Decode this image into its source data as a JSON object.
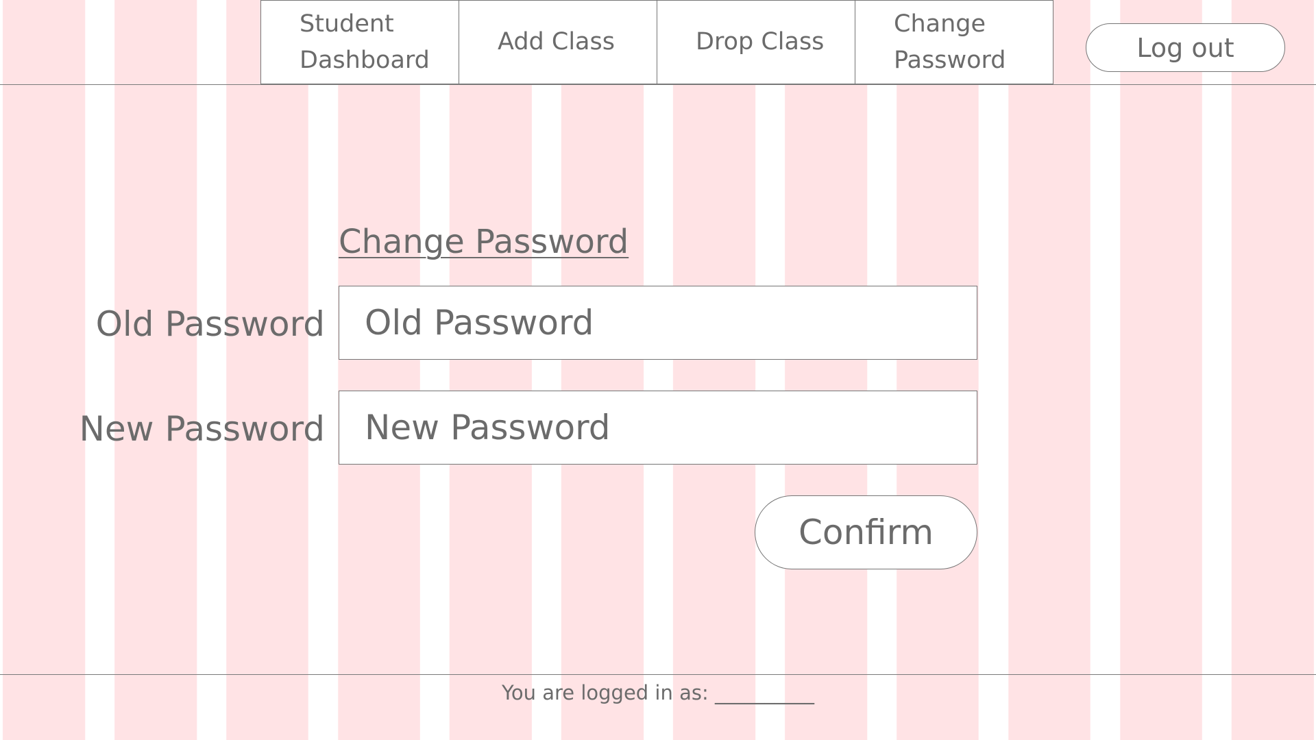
{
  "nav": {
    "tabs": [
      {
        "line1": "Student",
        "line2": "Dashboard"
      },
      {
        "line1": "Add Class",
        "line2": ""
      },
      {
        "line1": "Drop Class",
        "line2": ""
      },
      {
        "line1": "Change",
        "line2": "Password"
      }
    ],
    "logout_label": "Log out"
  },
  "form": {
    "title": "Change Password",
    "old_password": {
      "label": "Old Password",
      "placeholder": "Old Password",
      "value": ""
    },
    "new_password": {
      "label": "New Password",
      "placeholder": "New Password",
      "value": ""
    },
    "confirm_label": "Confirm"
  },
  "footer": {
    "logged_in_text": "You are logged in as: __________"
  },
  "colors": {
    "grid_column": "#ffe3e5",
    "text": "#6b6b6b",
    "border": "#757575",
    "background": "#ffffff"
  }
}
